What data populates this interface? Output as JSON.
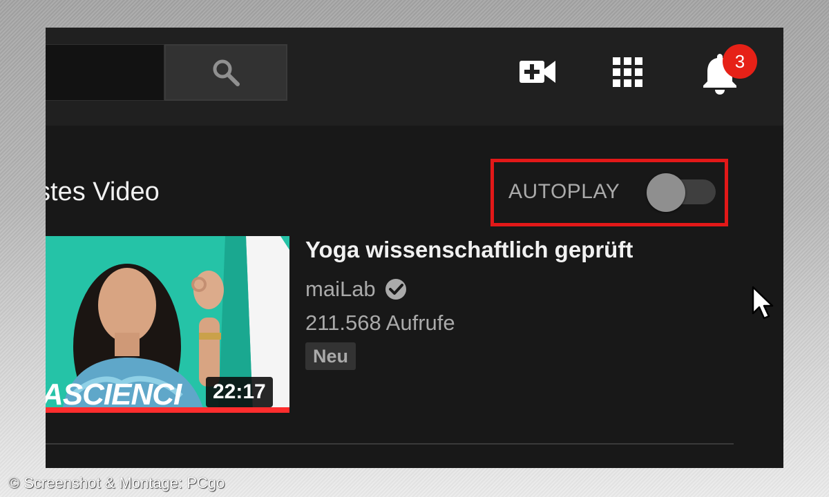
{
  "header": {
    "search_placeholder": "",
    "icons": [
      "search-icon",
      "video-camera-plus-icon",
      "apps-grid-icon",
      "bell-icon"
    ],
    "notification_count": "3"
  },
  "sidebar": {
    "up_next_label": "stes Video",
    "autoplay_label": "AUTOPLAY",
    "autoplay_on": false,
    "video": {
      "title": "Yoga wissenschaftlich geprüft",
      "channel": "maiLab",
      "verified": true,
      "views": "211.568 Aufrufe",
      "badge": "Neu",
      "duration": "22:17",
      "thumbnail_text": "ASCIENCI"
    }
  },
  "colors": {
    "background": "#181818",
    "header": "#202020",
    "highlight_box": "#e21818",
    "badge": "#e62117",
    "thumbnail_teal": "#24c1a6",
    "progress_red": "#ff2d2d"
  },
  "caption": "© Screenshot & Montage: PCgo"
}
